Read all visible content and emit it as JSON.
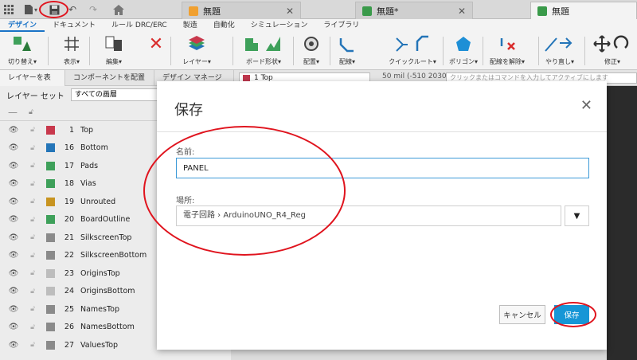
{
  "tabs": [
    {
      "label": "無題",
      "active": false,
      "icon_color": "#f0a030"
    },
    {
      "label": "無題*",
      "active": false,
      "icon_color": "#3a9a4a"
    },
    {
      "label": "無題",
      "active": true,
      "icon_color": "#3a9a4a"
    }
  ],
  "ribbon_tabs": [
    "デザイン",
    "ドキュメント",
    "ルール DRC/ERC",
    "製造",
    "自動化",
    "シミュレーション",
    "ライブラリ"
  ],
  "ribbon_tools": [
    {
      "label": "切り替え▾",
      "icon": "switch-icon"
    },
    {
      "label": "表示▾",
      "icon": "grid-icon"
    },
    {
      "label": "編集▾",
      "icon": "copy-icon"
    },
    {
      "label": "",
      "icon": "delete-icon"
    },
    {
      "label": "レイヤー▾",
      "icon": "layers-icon"
    },
    {
      "label": "ボード形状▾",
      "icon": "board-shape-icon"
    },
    {
      "label": "配置▾",
      "icon": "place-icon"
    },
    {
      "label": "配線▾",
      "icon": "route-icon"
    },
    {
      "label": "クイックルート▾",
      "icon": "quick-route-icon"
    },
    {
      "label": "ポリゴン▾",
      "icon": "polygon-icon"
    },
    {
      "label": "配線を解除▾",
      "icon": "unroute-icon"
    },
    {
      "label": "やり直し▾",
      "icon": "redo-route-icon"
    },
    {
      "label": "修正▾",
      "icon": "move-icon"
    }
  ],
  "panel_tabs": [
    "レイヤーを表示",
    "コンポーネントを配置",
    "デザイン マネージャ"
  ],
  "layer_selector": "1 Top",
  "coordinates": "50 mil (-510 2030)",
  "command_placeholder": "クリックまたはコマンドを入力してアクティブにします",
  "layer_set_label": "レイヤー セット",
  "layer_set_value": "すべての画層",
  "layers": [
    {
      "num": "1",
      "name": "Top",
      "color": "#c8384c"
    },
    {
      "num": "16",
      "name": "Bottom",
      "color": "#2475b8"
    },
    {
      "num": "17",
      "name": "Pads",
      "color": "#3ea05a"
    },
    {
      "num": "18",
      "name": "Vias",
      "color": "#3ea05a"
    },
    {
      "num": "19",
      "name": "Unrouted",
      "color": "#c89420"
    },
    {
      "num": "20",
      "name": "BoardOutline",
      "color": "#3ea05a"
    },
    {
      "num": "21",
      "name": "SilkscreenTop",
      "color": "#8a8a8a"
    },
    {
      "num": "22",
      "name": "SilkscreenBottom",
      "color": "#8a8a8a"
    },
    {
      "num": "23",
      "name": "OriginsTop",
      "color": "#bdbdbd"
    },
    {
      "num": "24",
      "name": "OriginsBottom",
      "color": "#bdbdbd"
    },
    {
      "num": "25",
      "name": "NamesTop",
      "color": "#8a8a8a"
    },
    {
      "num": "26",
      "name": "NamesBottom",
      "color": "#8a8a8a"
    },
    {
      "num": "27",
      "name": "ValuesTop",
      "color": "#8a8a8a"
    }
  ],
  "dialog": {
    "title": "保存",
    "name_label": "名前:",
    "name_value": "PANEL",
    "location_label": "場所:",
    "location_value": "電子回路 › ArduinoUNO_R4_Reg",
    "cancel": "キャンセル",
    "save": "保存"
  },
  "colors": {
    "accent": "#1696d6",
    "annotation": "#e0141e"
  }
}
